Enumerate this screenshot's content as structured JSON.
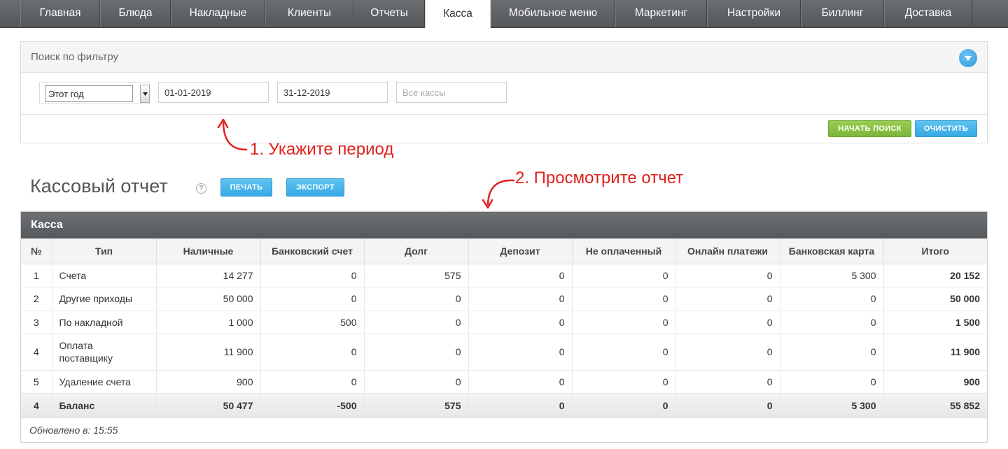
{
  "nav": {
    "tabs": [
      {
        "label": "Главная"
      },
      {
        "label": "Блюда"
      },
      {
        "label": "Накладные"
      },
      {
        "label": "Клиенты"
      },
      {
        "label": "Отчеты"
      },
      {
        "label": "Касса"
      },
      {
        "label": "Мобильное меню"
      },
      {
        "label": "Маркетинг"
      },
      {
        "label": "Настройки"
      },
      {
        "label": "Биллинг"
      },
      {
        "label": "Доставка"
      }
    ],
    "active": "Касса"
  },
  "filter": {
    "title": "Поиск по фильтру",
    "period_value": "Этот год",
    "date_from": "01-01-2019",
    "date_to": "31-12-2019",
    "cash_placeholder": "Все кассы",
    "search_label": "Начать поиск",
    "clear_label": "Очистить"
  },
  "annotations": {
    "step1": "1. Укажите период",
    "step2": "2. Просмотрите отчет"
  },
  "report": {
    "title": "Кассовый отчет",
    "help": "?",
    "print_label": "Печать",
    "export_label": "Экспорт",
    "panel_title": "Касса",
    "columns": [
      "№",
      "Тип",
      "Наличные",
      "Банковский счет",
      "Долг",
      "Депозит",
      "Не оплаченный",
      "Онлайн платежи",
      "Банковская карта",
      "Итого"
    ],
    "rows": [
      {
        "n": "1",
        "type": "Счета",
        "cash": "14 277",
        "bank": "0",
        "debt": "575",
        "deposit": "0",
        "unpaid": "0",
        "online": "0",
        "card": "5 300",
        "total": "20 152"
      },
      {
        "n": "2",
        "type": "Другие приходы",
        "cash": "50 000",
        "bank": "0",
        "debt": "0",
        "deposit": "0",
        "unpaid": "0",
        "online": "0",
        "card": "0",
        "total": "50 000"
      },
      {
        "n": "3",
        "type": "По накладной",
        "cash": "1 000",
        "bank": "500",
        "debt": "0",
        "deposit": "0",
        "unpaid": "0",
        "online": "0",
        "card": "0",
        "total": "1 500"
      },
      {
        "n": "4",
        "type": "Оплата поставщику",
        "cash": "11 900",
        "bank": "0",
        "debt": "0",
        "deposit": "0",
        "unpaid": "0",
        "online": "0",
        "card": "0",
        "total": "11 900"
      },
      {
        "n": "5",
        "type": "Удаление счета",
        "cash": "900",
        "bank": "0",
        "debt": "0",
        "deposit": "0",
        "unpaid": "0",
        "online": "0",
        "card": "0",
        "total": "900"
      }
    ],
    "balance": {
      "n": "4",
      "type": "Баланс",
      "cash": "50 477",
      "bank": "-500",
      "debt": "575",
      "deposit": "0",
      "unpaid": "0",
      "online": "0",
      "card": "5 300",
      "total": "55 852"
    },
    "updated": "Обновлено в: 15:55"
  },
  "colors": {
    "accent_blue": "#37a9e4",
    "accent_green": "#7bb63a",
    "annotation_red": "#e0201b"
  }
}
